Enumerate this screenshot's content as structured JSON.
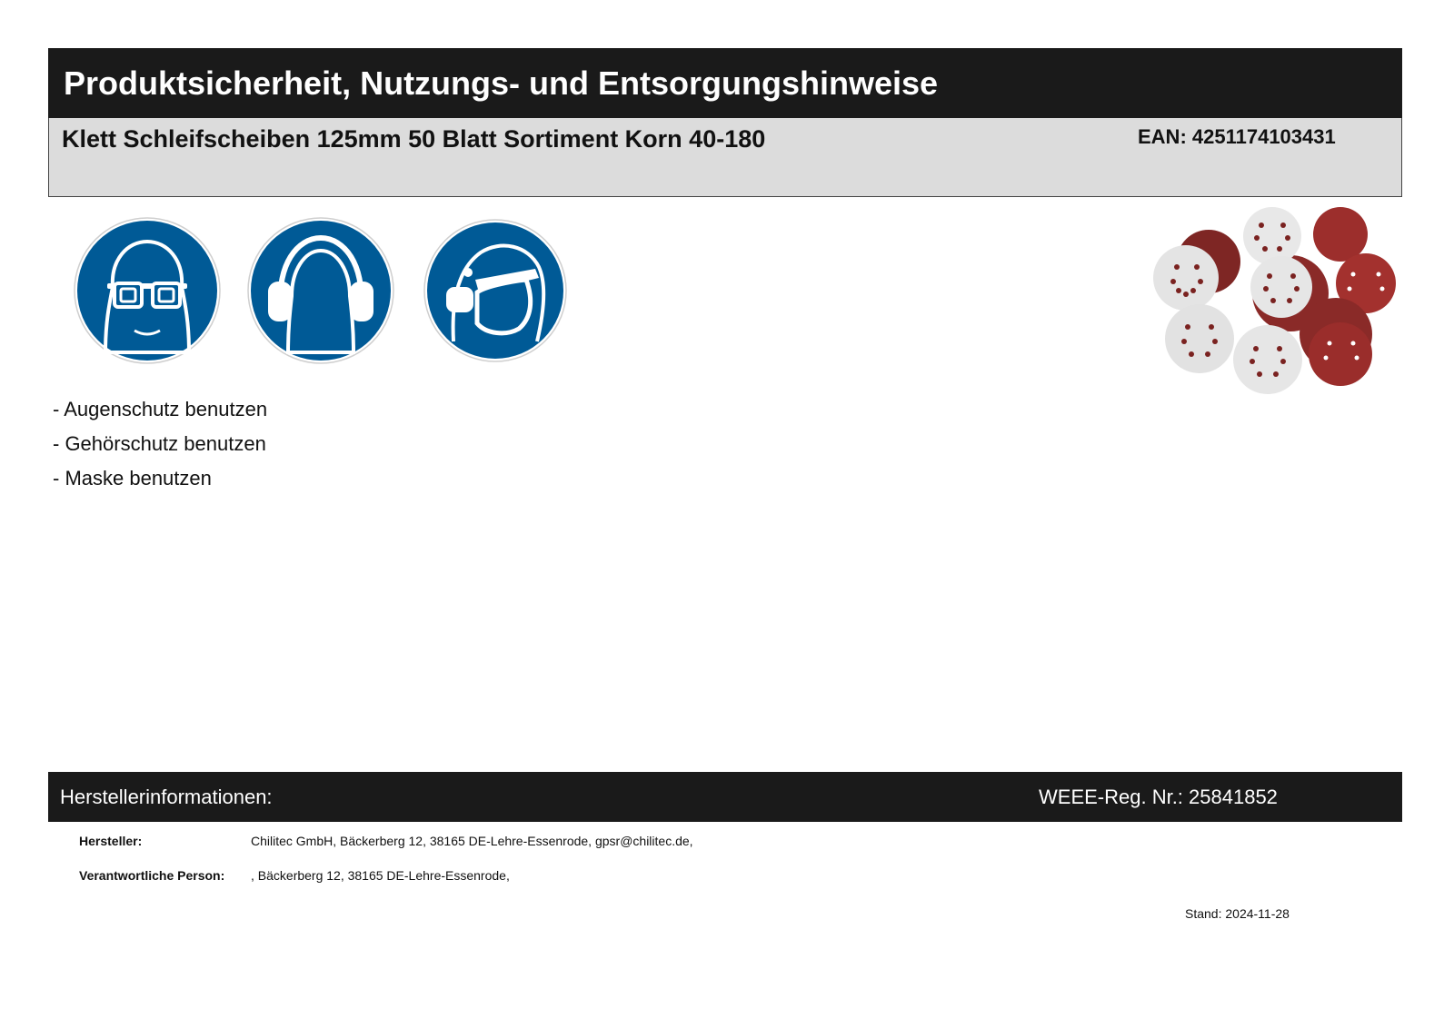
{
  "header": {
    "title": "Produktsicherheit, Nutzungs- und Entsorgungshinweise"
  },
  "product": {
    "name": "Klett Schleifscheiben 125mm 50 Blatt Sortiment Korn 40-180",
    "ean": "EAN: 4251174103431"
  },
  "signs": [
    {
      "icon": "eye-protection-sign-icon"
    },
    {
      "icon": "hearing-protection-sign-icon"
    },
    {
      "icon": "mask-sign-icon"
    }
  ],
  "instructions": [
    "- Augenschutz benutzen",
    "- Gehörschutz benutzen",
    "- Maske benutzen"
  ],
  "manufacturer": {
    "title": "Herstellerinformationen:",
    "weee": "WEEE-Reg. Nr.: 25841852",
    "rows": [
      {
        "label": "Hersteller:",
        "value": "Chilitec GmbH, Bäckerberg 12, 38165 DE-Lehre-Essenrode, gpsr@chilitec.de,"
      },
      {
        "label": "Verantwortliche Person:",
        "value": ", Bäckerberg 12, 38165 DE-Lehre-Essenrode,"
      }
    ]
  },
  "stand": "Stand: 2024-11-28",
  "colors": {
    "sign_blue": "#005a96",
    "bar_dark": "#1a1a1a",
    "bar_light": "#dcdcdc",
    "disc_red": "#8a2a28",
    "disc_white": "#e4e4e4"
  }
}
